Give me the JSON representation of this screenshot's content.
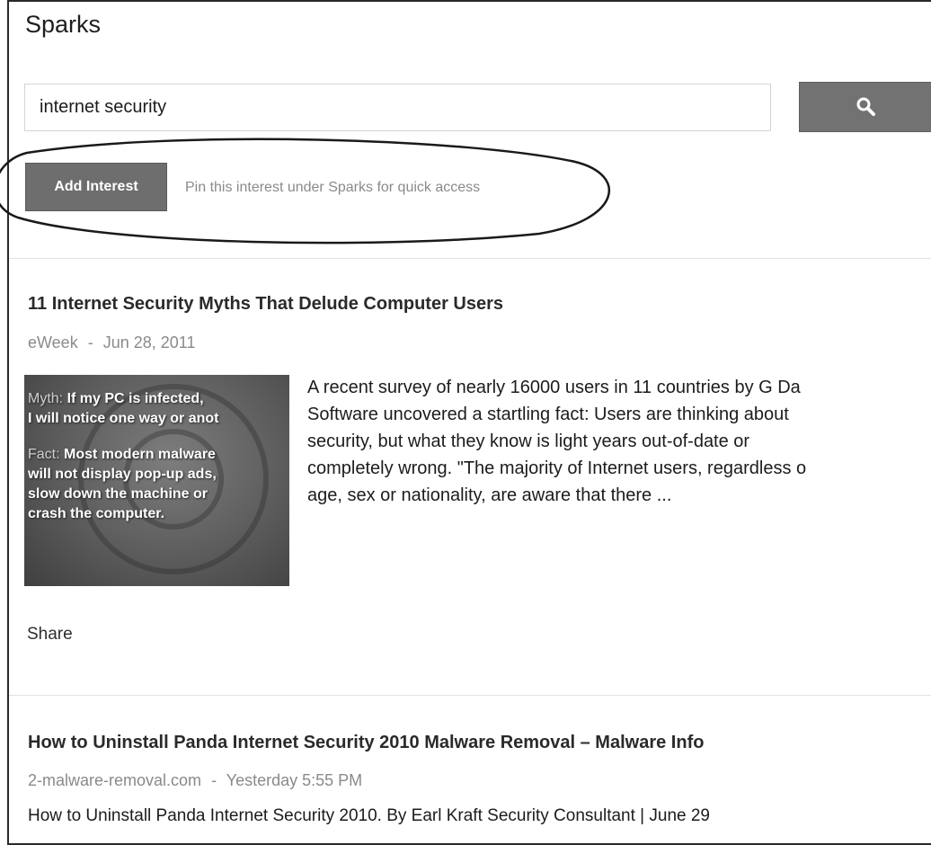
{
  "page_title": "Sparks",
  "search": {
    "value": "internet security",
    "button_icon": "search-icon"
  },
  "add_interest": {
    "label": "Add Interest",
    "hint": "Pin this interest under Sparks for quick access"
  },
  "articles": [
    {
      "title": "11 Internet Security Myths That Delude Computer Users",
      "source": "eWeek",
      "separator": "-",
      "date": "Jun 28, 2011",
      "image": {
        "myth_label": "Myth:",
        "myth_line1": "If my PC is infected,",
        "myth_line2": "I will notice one way or anot",
        "fact_label": "Fact:",
        "fact_line1": "Most modern malware",
        "fact_line2": "will not display pop-up ads,",
        "fact_line3": "slow down the machine or",
        "fact_line4": "crash the computer."
      },
      "summary_lines": [
        "A recent survey of nearly 16000 users in 11 countries by G Da",
        "Software uncovered a startling fact: Users are thinking about",
        "security, but what they know is light years out-of-date or",
        "completely wrong. \"The majority of Internet users, regardless o",
        "age, sex or nationality, are aware that there ..."
      ],
      "share_label": "Share"
    },
    {
      "title": "How to Uninstall Panda Internet Security 2010 Malware Removal – Malware Info",
      "source": "2-malware-removal.com",
      "separator": "-",
      "date": "Yesterday 5:55 PM",
      "snippet": "How to Uninstall Panda Internet Security 2010. By Earl Kraft Security Consultant | June 29"
    }
  ],
  "colors": {
    "button_bg": "#727272",
    "hint_text": "#8a8a8a",
    "divider": "#e2e2e2"
  }
}
